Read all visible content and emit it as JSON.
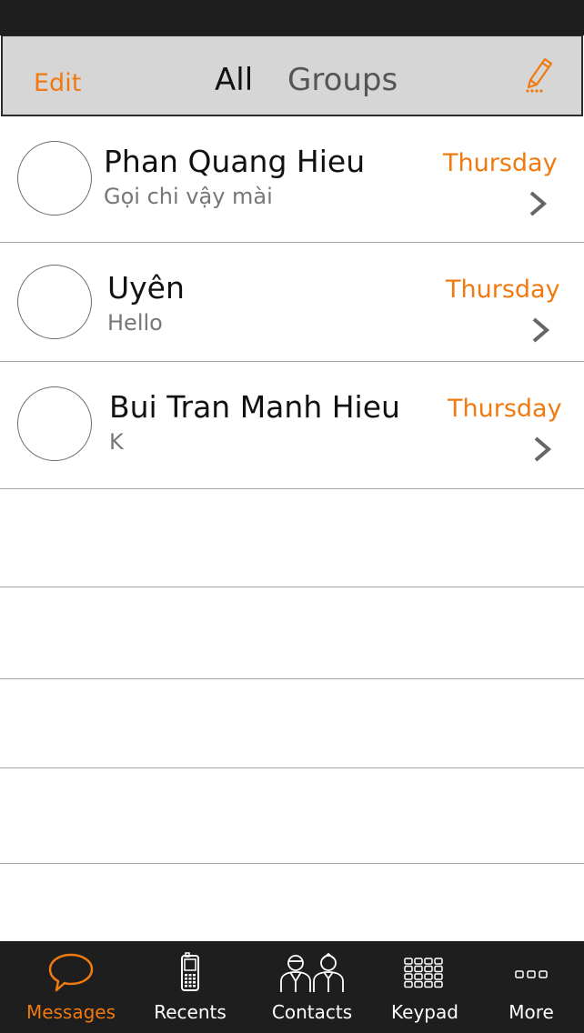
{
  "nav": {
    "edit_label": "Edit",
    "tabs": [
      {
        "label": "All",
        "active": true
      },
      {
        "label": "Groups",
        "active": false
      }
    ],
    "compose_icon": "pencil-icon"
  },
  "conversations": [
    {
      "name": "Phan Quang Hieu",
      "preview": "Gọi chi vậy mài",
      "date": "Thursday"
    },
    {
      "name": "Uyên",
      "preview": "Hello",
      "date": "Thursday"
    },
    {
      "name": "Bui Tran Manh Hieu",
      "preview": "K",
      "date": "Thursday"
    }
  ],
  "tab_bar": {
    "items": [
      {
        "label": "Messages",
        "icon": "speech-bubble-icon",
        "active": true
      },
      {
        "label": "Recents",
        "icon": "phone-icon",
        "active": false
      },
      {
        "label": "Contacts",
        "icon": "people-icon",
        "active": false
      },
      {
        "label": "Keypad",
        "icon": "keypad-icon",
        "active": false
      },
      {
        "label": "More",
        "icon": "more-icon",
        "active": false
      }
    ]
  },
  "colors": {
    "accent": "#f07a10",
    "bar_dark": "#1e1e1e",
    "nav_bg": "#d6d6d6"
  }
}
